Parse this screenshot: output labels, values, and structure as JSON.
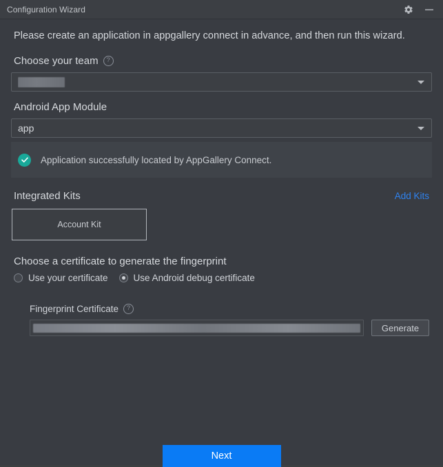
{
  "window": {
    "title": "Configuration Wizard",
    "settings_icon": "gear-icon",
    "minimize_icon": "minimize-icon"
  },
  "intro": {
    "text": "Please create an application in appgallery connect in advance, and then run this wizard."
  },
  "team": {
    "label": "Choose your team",
    "help_icon": "?",
    "value": "",
    "value_redacted": true
  },
  "module": {
    "label": "Android App Module",
    "value": "app",
    "status": {
      "icon": "check-circle-icon",
      "text": "Application successfully located by AppGallery Connect."
    }
  },
  "kits": {
    "title": "Integrated Kits",
    "add_label": "Add Kits",
    "items": [
      {
        "label": "Account Kit"
      }
    ]
  },
  "certificate": {
    "heading": "Choose a certificate to generate the fingerprint",
    "options": [
      {
        "label": "Use your certificate",
        "selected": false
      },
      {
        "label": "Use Android debug certificate",
        "selected": true
      }
    ]
  },
  "fingerprint": {
    "label": "Fingerprint Certificate",
    "help_icon": "?",
    "value": "",
    "value_redacted": true,
    "generate_label": "Generate"
  },
  "footer": {
    "next_label": "Next"
  },
  "colors": {
    "window_bg": "#393c42",
    "titlebar_bg": "#3c3f44",
    "accent_blue": "#0a7bf5",
    "link_blue": "#2f83f0",
    "success_green": "#19a99a",
    "text_primary": "#d7dade",
    "field_bg": "#3c3f44",
    "field_border": "#5a5e64"
  }
}
